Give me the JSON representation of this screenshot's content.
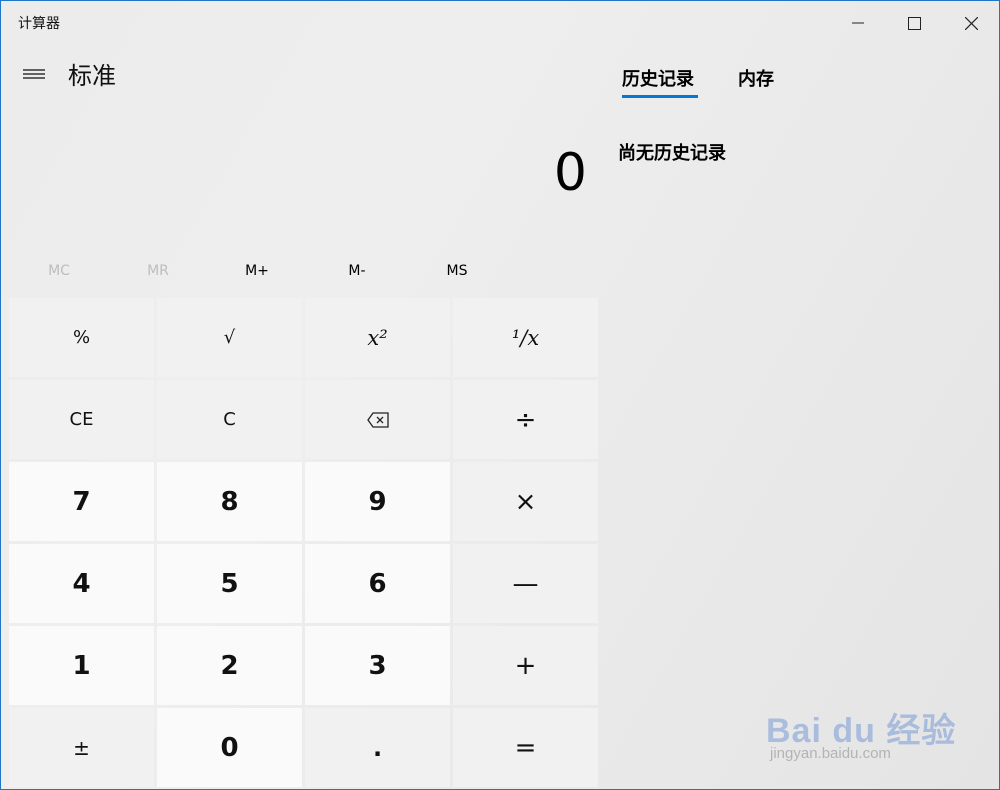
{
  "window": {
    "title": "计算器"
  },
  "header": {
    "mode": "标准"
  },
  "display": {
    "value": "0"
  },
  "memory": [
    "MC",
    "MR",
    "M+",
    "M-",
    "MS"
  ],
  "keys": {
    "percent": "%",
    "sqrt": "√",
    "square": "x²",
    "reciprocal": "¹/x",
    "clear_entry": "CE",
    "clear": "C",
    "backspace": "⌫",
    "divide": "÷",
    "seven": "7",
    "eight": "8",
    "nine": "9",
    "multiply": "×",
    "four": "4",
    "five": "5",
    "six": "6",
    "minus": "—",
    "one": "1",
    "two": "2",
    "three": "3",
    "plus": "+",
    "negate": "±",
    "zero": "0",
    "decimal": ".",
    "equals": "="
  },
  "panel": {
    "tabs": [
      "历史记录",
      "内存"
    ],
    "empty_message": "尚无历史记录"
  },
  "watermark": {
    "brand": "Bai du 经验",
    "url": "jingyan.baidu.com"
  },
  "colors": {
    "accent": "#0078d7"
  }
}
